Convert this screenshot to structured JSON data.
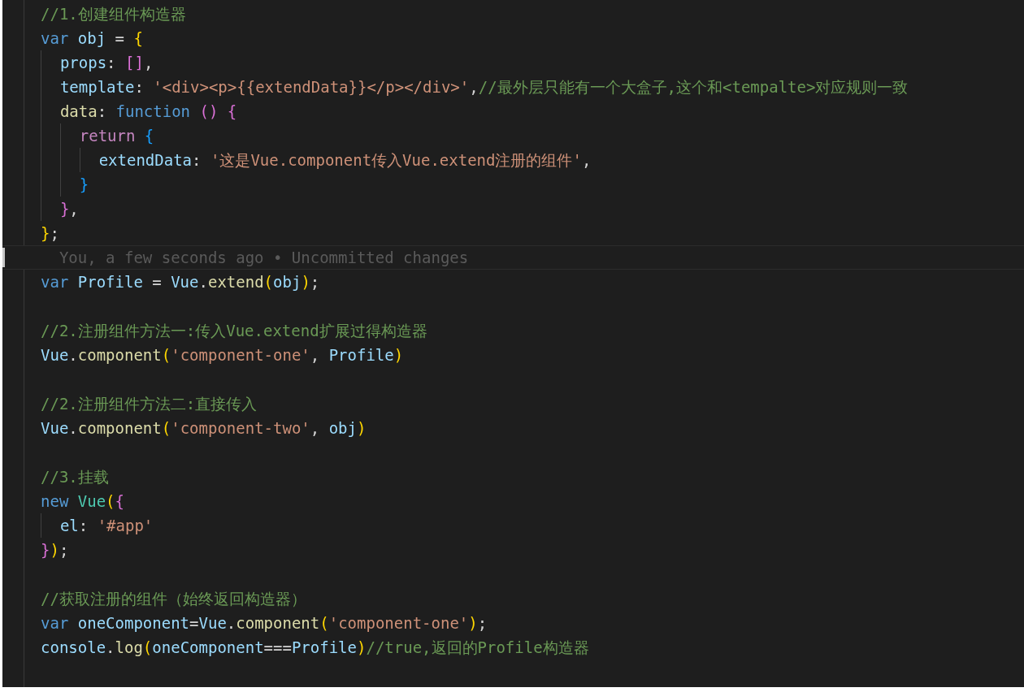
{
  "editor": {
    "lines": [
      {
        "kind": "code",
        "tokens": [
          {
            "text": "//1.创建组件构造器",
            "kind": "cmt"
          }
        ]
      },
      {
        "kind": "code",
        "tokens": [
          {
            "text": "var ",
            "kind": "kw"
          },
          {
            "text": "obj",
            "kind": "var"
          },
          {
            "text": " = ",
            "kind": "text"
          },
          {
            "text": "{",
            "kind": "b1"
          }
        ]
      },
      {
        "kind": "code",
        "tokens": [
          {
            "text": "  props",
            "kind": "var"
          },
          {
            "text": ": ",
            "kind": "text"
          },
          {
            "text": "[]",
            "kind": "b2"
          },
          {
            "text": ",",
            "kind": "text"
          }
        ]
      },
      {
        "kind": "code",
        "tokens": [
          {
            "text": "  template",
            "kind": "var"
          },
          {
            "text": ": ",
            "kind": "text"
          },
          {
            "text": "'<div><p>{{extendData}}</p></div>'",
            "kind": "str"
          },
          {
            "text": ",",
            "kind": "text"
          },
          {
            "text": "//最外层只能有一个大盒子,这个和<tempalte>对应规则一致",
            "kind": "cmt"
          }
        ]
      },
      {
        "kind": "code",
        "tokens": [
          {
            "text": "  data",
            "kind": "fn"
          },
          {
            "text": ": ",
            "kind": "text"
          },
          {
            "text": "function ",
            "kind": "kw"
          },
          {
            "text": "() ",
            "kind": "b2"
          },
          {
            "text": "{",
            "kind": "b2"
          }
        ]
      },
      {
        "kind": "code",
        "tokens": [
          {
            "text": "    return ",
            "kind": "ctl"
          },
          {
            "text": "{",
            "kind": "b3"
          }
        ]
      },
      {
        "kind": "code",
        "tokens": [
          {
            "text": "      extendData",
            "kind": "var"
          },
          {
            "text": ": ",
            "kind": "text"
          },
          {
            "text": "'这是Vue.component传入Vue.extend注册的组件'",
            "kind": "str"
          },
          {
            "text": ",",
            "kind": "text"
          }
        ]
      },
      {
        "kind": "code",
        "tokens": [
          {
            "text": "    }",
            "kind": "b3"
          }
        ]
      },
      {
        "kind": "code",
        "tokens": [
          {
            "text": "  }",
            "kind": "b2"
          },
          {
            "text": ",",
            "kind": "text"
          }
        ]
      },
      {
        "kind": "code",
        "tokens": [
          {
            "text": "}",
            "kind": "b1"
          },
          {
            "text": ";",
            "kind": "text"
          }
        ]
      },
      {
        "kind": "blame",
        "tokens": [
          {
            "text": "  You, a few seconds ago • Uncommitted changes",
            "kind": "blame"
          }
        ]
      },
      {
        "kind": "code",
        "tokens": [
          {
            "text": "var ",
            "kind": "kw"
          },
          {
            "text": "Profile",
            "kind": "var"
          },
          {
            "text": " = ",
            "kind": "text"
          },
          {
            "text": "Vue",
            "kind": "var"
          },
          {
            "text": ".",
            "kind": "text"
          },
          {
            "text": "extend",
            "kind": "fn"
          },
          {
            "text": "(",
            "kind": "b1"
          },
          {
            "text": "obj",
            "kind": "var"
          },
          {
            "text": ")",
            "kind": "b1"
          },
          {
            "text": ";",
            "kind": "text"
          }
        ]
      },
      {
        "kind": "blank"
      },
      {
        "kind": "code",
        "tokens": [
          {
            "text": "//2.注册组件方法一:传入Vue.extend扩展过得构造器",
            "kind": "cmt"
          }
        ]
      },
      {
        "kind": "code",
        "tokens": [
          {
            "text": "Vue",
            "kind": "var"
          },
          {
            "text": ".",
            "kind": "text"
          },
          {
            "text": "component",
            "kind": "fn"
          },
          {
            "text": "(",
            "kind": "b1"
          },
          {
            "text": "'component-one'",
            "kind": "str"
          },
          {
            "text": ", ",
            "kind": "text"
          },
          {
            "text": "Profile",
            "kind": "var"
          },
          {
            "text": ")",
            "kind": "b1"
          }
        ]
      },
      {
        "kind": "blank"
      },
      {
        "kind": "code",
        "tokens": [
          {
            "text": "//2.注册组件方法二:直接传入",
            "kind": "cmt"
          }
        ]
      },
      {
        "kind": "code",
        "tokens": [
          {
            "text": "Vue",
            "kind": "var"
          },
          {
            "text": ".",
            "kind": "text"
          },
          {
            "text": "component",
            "kind": "fn"
          },
          {
            "text": "(",
            "kind": "b1"
          },
          {
            "text": "'component-two'",
            "kind": "str"
          },
          {
            "text": ", ",
            "kind": "text"
          },
          {
            "text": "obj",
            "kind": "var"
          },
          {
            "text": ")",
            "kind": "b1"
          }
        ]
      },
      {
        "kind": "blank"
      },
      {
        "kind": "code",
        "tokens": [
          {
            "text": "//3.挂载",
            "kind": "cmt"
          }
        ]
      },
      {
        "kind": "code",
        "tokens": [
          {
            "text": "new ",
            "kind": "kw"
          },
          {
            "text": "Vue",
            "kind": "cls"
          },
          {
            "text": "(",
            "kind": "b1"
          },
          {
            "text": "{",
            "kind": "b2"
          }
        ]
      },
      {
        "kind": "code",
        "tokens": [
          {
            "text": "  el",
            "kind": "var"
          },
          {
            "text": ": ",
            "kind": "text"
          },
          {
            "text": "'#app'",
            "kind": "str"
          }
        ]
      },
      {
        "kind": "code",
        "tokens": [
          {
            "text": "}",
            "kind": "b2"
          },
          {
            "text": ")",
            "kind": "b1"
          },
          {
            "text": ";",
            "kind": "text"
          }
        ]
      },
      {
        "kind": "blank"
      },
      {
        "kind": "code",
        "tokens": [
          {
            "text": "//获取注册的组件（始终返回构造器）",
            "kind": "cmt"
          }
        ]
      },
      {
        "kind": "code",
        "tokens": [
          {
            "text": "var ",
            "kind": "kw"
          },
          {
            "text": "oneComponent",
            "kind": "var"
          },
          {
            "text": "=",
            "kind": "text"
          },
          {
            "text": "Vue",
            "kind": "var"
          },
          {
            "text": ".",
            "kind": "text"
          },
          {
            "text": "component",
            "kind": "fn"
          },
          {
            "text": "(",
            "kind": "b1"
          },
          {
            "text": "'component-one'",
            "kind": "str"
          },
          {
            "text": ")",
            "kind": "b1"
          },
          {
            "text": ";",
            "kind": "text"
          }
        ]
      },
      {
        "kind": "code",
        "tokens": [
          {
            "text": "console",
            "kind": "var"
          },
          {
            "text": ".",
            "kind": "text"
          },
          {
            "text": "log",
            "kind": "fn"
          },
          {
            "text": "(",
            "kind": "b1"
          },
          {
            "text": "oneComponent",
            "kind": "var"
          },
          {
            "text": "===",
            "kind": "text"
          },
          {
            "text": "Profile",
            "kind": "var"
          },
          {
            "text": ")",
            "kind": "b1"
          },
          {
            "text": "//true,返回的Profile构造器",
            "kind": "cmt"
          }
        ]
      }
    ]
  }
}
